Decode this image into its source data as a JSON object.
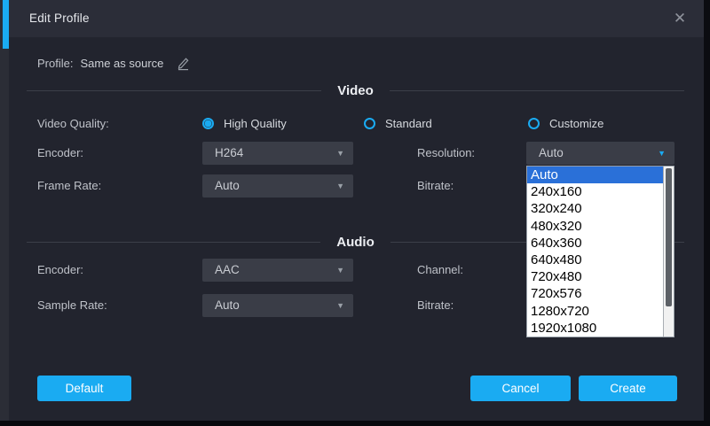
{
  "dialog": {
    "title": "Edit Profile",
    "close_glyph": "✕",
    "profile": {
      "label": "Profile:",
      "value": "Same as source"
    },
    "sections": {
      "video": "Video",
      "audio": "Audio"
    },
    "video": {
      "quality_label": "Video Quality:",
      "quality_options": [
        "High Quality",
        "Standard",
        "Customize"
      ],
      "quality_selected": "High Quality",
      "encoder_label": "Encoder:",
      "encoder_value": "H264",
      "resolution_label": "Resolution:",
      "resolution_value": "Auto",
      "framerate_label": "Frame Rate:",
      "framerate_value": "Auto",
      "bitrate_label": "Bitrate:"
    },
    "audio": {
      "encoder_label": "Encoder:",
      "encoder_value": "AAC",
      "channel_label": "Channel:",
      "samplerate_label": "Sample Rate:",
      "samplerate_value": "Auto",
      "bitrate_label": "Bitrate:"
    },
    "buttons": {
      "default": "Default",
      "cancel": "Cancel",
      "create": "Create"
    }
  },
  "resolution_dropdown": {
    "selected": "Auto",
    "options": [
      "Auto",
      "240x160",
      "320x240",
      "480x320",
      "640x360",
      "640x480",
      "720x480",
      "720x576",
      "1280x720",
      "1920x1080"
    ]
  },
  "glyphs": {
    "dropdown_arrow": "▼"
  },
  "colors": {
    "accent": "#1aabf2",
    "selection": "#2a70d8"
  }
}
